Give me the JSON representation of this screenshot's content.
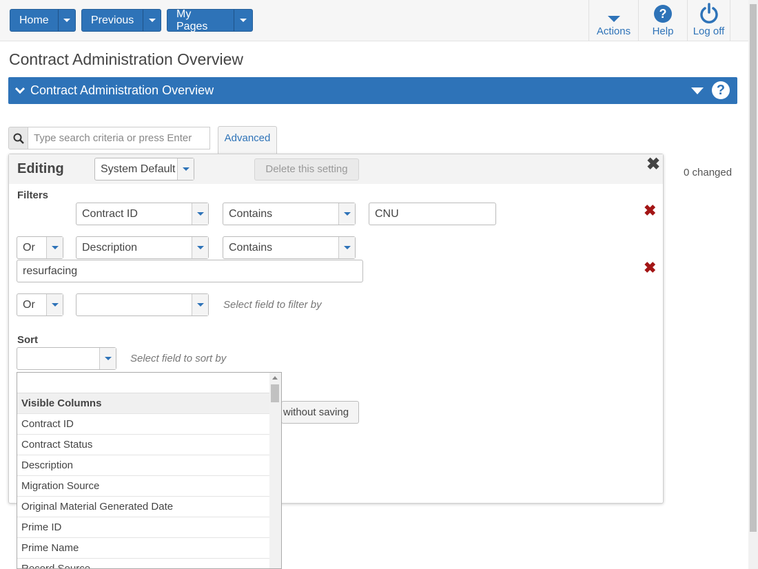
{
  "nav": {
    "home": "Home",
    "previous": "Previous",
    "my_pages": "My Pages",
    "actions": "Actions",
    "help": "Help",
    "log_off": "Log off"
  },
  "page_title": "Contract Administration Overview",
  "panel_title": "Contract Administration Overview",
  "search": {
    "placeholder": "Type search criteria or press Enter",
    "advanced": "Advanced"
  },
  "changed_text": "0 changed",
  "editor": {
    "title": "Editing",
    "setting": "System Default",
    "delete_label": "Delete this setting",
    "filters_label": "Filters",
    "filters": [
      {
        "field": "Contract ID",
        "operator": "Contains",
        "value": "CNU"
      },
      {
        "conjunction": "Or",
        "field": "Description",
        "operator": "Contains",
        "value": "resurfacing"
      },
      {
        "conjunction": "Or",
        "field": "",
        "hint": "Select field to filter by"
      }
    ],
    "sort_label": "Sort",
    "sort_hint": "Select field to sort by",
    "partial_button": "without saving"
  },
  "dropdown": {
    "group": "Visible Columns",
    "items": [
      "Contract ID",
      "Contract Status",
      "Description",
      "Migration Source",
      "Original Material Generated Date",
      "Prime ID",
      "Prime Name",
      "Record Source"
    ]
  },
  "colors": {
    "primary": "#2e73b8",
    "danger": "#a31515"
  }
}
